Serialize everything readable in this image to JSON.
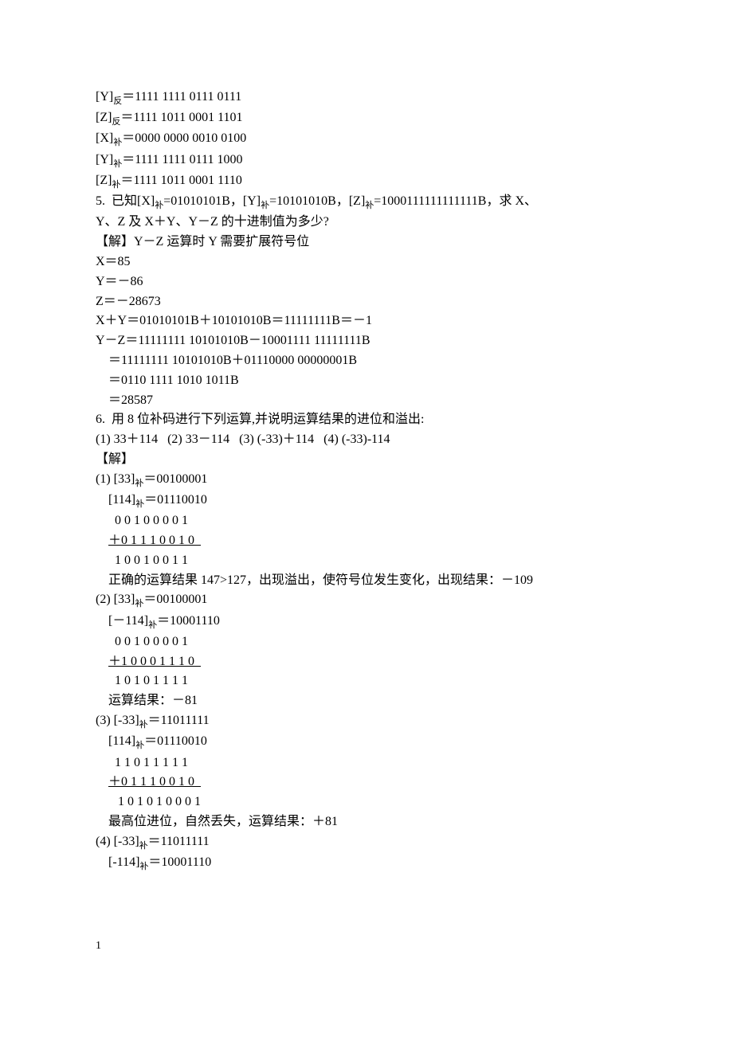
{
  "lines": [
    {
      "parts": [
        {
          "t": "[Y]"
        },
        {
          "t": "反",
          "sub": true
        },
        {
          "t": "＝1111 1111 0111 0111"
        }
      ]
    },
    {
      "parts": [
        {
          "t": "[Z]"
        },
        {
          "t": "反",
          "sub": true
        },
        {
          "t": "＝1111 1011 0001 1101"
        }
      ]
    },
    {
      "parts": [
        {
          "t": "[X]"
        },
        {
          "t": "补",
          "sub": true
        },
        {
          "t": "＝0000 0000 0010 0100"
        }
      ]
    },
    {
      "parts": [
        {
          "t": "[Y]"
        },
        {
          "t": "补",
          "sub": true
        },
        {
          "t": "＝1111 1111 0111 1000"
        }
      ]
    },
    {
      "parts": [
        {
          "t": "[Z]"
        },
        {
          "t": "补",
          "sub": true
        },
        {
          "t": "＝1111 1011 0001 1110"
        }
      ]
    },
    {
      "parts": [
        {
          "t": "5.  已知[X]"
        },
        {
          "t": "补",
          "sub": true
        },
        {
          "t": "=01010101B，[Y]"
        },
        {
          "t": "补",
          "sub": true
        },
        {
          "t": "=10101010B，[Z]"
        },
        {
          "t": "补",
          "sub": true
        },
        {
          "t": "=1000111111111111B，求 X、"
        }
      ]
    },
    {
      "parts": [
        {
          "t": "Y、Z 及 X＋Y、Y－Z 的十进制值为多少?"
        }
      ]
    },
    {
      "parts": [
        {
          "t": "【解】Y－Z 运算时 Y 需要扩展符号位"
        }
      ]
    },
    {
      "parts": [
        {
          "t": "X＝85"
        }
      ]
    },
    {
      "parts": [
        {
          "t": "Y＝－86"
        }
      ]
    },
    {
      "parts": [
        {
          "t": "Z＝－28673"
        }
      ]
    },
    {
      "parts": [
        {
          "t": "X＋Y＝01010101B＋10101010B＝11111111B＝－1"
        }
      ]
    },
    {
      "parts": [
        {
          "t": "Y－Z＝11111111 10101010B－10001111 11111111B"
        }
      ]
    },
    {
      "parts": [
        {
          "t": "    ＝11111111 10101010B＋01110000 00000001B"
        }
      ]
    },
    {
      "parts": [
        {
          "t": "    ＝0110 1111 1010 1011B"
        }
      ]
    },
    {
      "parts": [
        {
          "t": "    ＝28587"
        }
      ]
    },
    {
      "parts": [
        {
          "t": "6.  用 8 位补码进行下列运算,并说明运算结果的进位和溢出:"
        }
      ]
    },
    {
      "parts": [
        {
          "t": "(1) 33＋114   (2) 33－114   (3) (-33)＋114   (4) (-33)-114"
        }
      ]
    },
    {
      "parts": [
        {
          "t": "【解】"
        }
      ]
    },
    {
      "parts": [
        {
          "t": "(1) [33]"
        },
        {
          "t": "补",
          "sub": true
        },
        {
          "t": "＝00100001"
        }
      ]
    },
    {
      "parts": [
        {
          "t": "    [114]"
        },
        {
          "t": "补",
          "sub": true
        },
        {
          "t": "＝01110010"
        }
      ]
    },
    {
      "parts": [
        {
          "t": "      0 0 1 0 0 0 0 1"
        }
      ]
    },
    {
      "parts": [
        {
          "t": "    "
        },
        {
          "t": "＋0 1 1 1 0 0 1 0  ",
          "u": true
        }
      ]
    },
    {
      "parts": [
        {
          "t": "      1 0 0 1 0 0 1 1"
        }
      ]
    },
    {
      "parts": [
        {
          "t": "    正确的运算结果 147>127，出现溢出，使符号位发生变化，出现结果：－109"
        }
      ]
    },
    {
      "parts": [
        {
          "t": "(2) [33]"
        },
        {
          "t": "补",
          "sub": true
        },
        {
          "t": "＝00100001"
        }
      ]
    },
    {
      "parts": [
        {
          "t": "    [－114]"
        },
        {
          "t": "补",
          "sub": true
        },
        {
          "t": "＝10001110"
        }
      ]
    },
    {
      "parts": [
        {
          "t": "      0 0 1 0 0 0 0 1"
        }
      ]
    },
    {
      "parts": [
        {
          "t": "    "
        },
        {
          "t": "＋1 0 0 0 1 1 1 0  ",
          "u": true
        }
      ]
    },
    {
      "parts": [
        {
          "t": "      1 0 1 0 1 1 1 1"
        }
      ]
    },
    {
      "parts": [
        {
          "t": "    运算结果：－81"
        }
      ]
    },
    {
      "parts": [
        {
          "t": "(3) [-33]"
        },
        {
          "t": "补",
          "sub": true
        },
        {
          "t": "＝11011111"
        }
      ]
    },
    {
      "parts": [
        {
          "t": "    [114]"
        },
        {
          "t": "补",
          "sub": true
        },
        {
          "t": "＝01110010"
        }
      ]
    },
    {
      "parts": [
        {
          "t": "      1 1 0 1 1 1 1 1"
        }
      ]
    },
    {
      "parts": [
        {
          "t": "    "
        },
        {
          "t": "＋0 1 1 1 0 0 1 0  ",
          "u": true
        }
      ]
    },
    {
      "parts": [
        {
          "t": "       1 0 1 0 1 0 0 0 1"
        }
      ]
    },
    {
      "parts": [
        {
          "t": "    最高位进位，自然丢失，运算结果：＋81"
        }
      ]
    },
    {
      "parts": [
        {
          "t": "(4) [-33]"
        },
        {
          "t": "补",
          "sub": true
        },
        {
          "t": "＝11011111"
        }
      ]
    },
    {
      "parts": [
        {
          "t": "    [-114]"
        },
        {
          "t": "补",
          "sub": true
        },
        {
          "t": "＝10001110"
        }
      ]
    }
  ],
  "footer": "1"
}
